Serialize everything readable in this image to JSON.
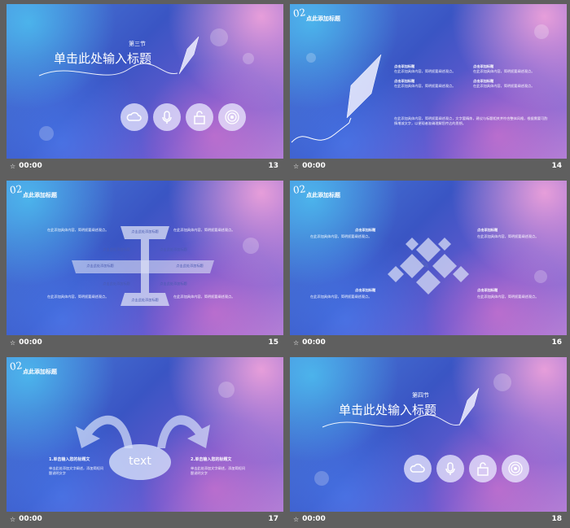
{
  "slides": [
    {
      "number": "13",
      "time": "00:00",
      "section": "第三节",
      "title": "单击此处输入标题",
      "icons": [
        "cloud-icon",
        "microphone-icon",
        "lock-icon",
        "podcast-icon"
      ]
    },
    {
      "number": "14",
      "time": "00:00",
      "corner": "02",
      "heading": "点此添加标题",
      "bullet_title": "点击添加标题",
      "para": "在此添加具体内容，简明扼要阐述观点。",
      "body": "在此添加具体内容，简明扼要阐述观点，文字要精炼，建议与标题相关并符合整体风格，根据需要可酌情增减文字，以便观者准确理解您传达的思想。"
    },
    {
      "number": "15",
      "time": "00:00",
      "corner": "02",
      "heading": "点此添加标题",
      "box_label": "点击此处添加标题",
      "para": "在此添加具体内容，简明扼要阐述观点。"
    },
    {
      "number": "16",
      "time": "00:00",
      "corner": "02",
      "heading": "点此添加标题",
      "label": "点击添加标题",
      "para": "在此添加具体内容，简明扼要阐述观点。"
    },
    {
      "number": "17",
      "time": "00:00",
      "corner": "02",
      "heading": "点此添加标题",
      "center_text": "text",
      "left_title": "1.单击输入您的标题文",
      "right_title": "2.单击输入您的标题文",
      "para": "单击此处添加文字阐述，添加简短问题说明文字"
    },
    {
      "number": "18",
      "time": "00:00",
      "section": "第四节",
      "title": "单击此处输入标题",
      "icons": [
        "cloud-icon",
        "microphone-icon",
        "lock-icon",
        "podcast-icon"
      ]
    }
  ]
}
